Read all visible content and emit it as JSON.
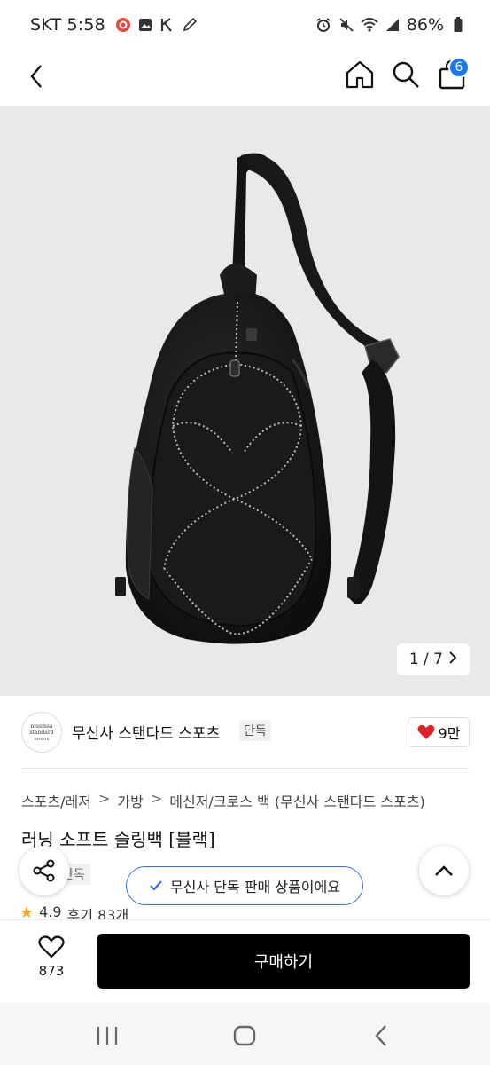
{
  "status_bar": {
    "carrier_time": "SKT 5:58",
    "battery": "86%",
    "icons_left": [
      "notification-app-icon",
      "gallery-icon",
      "k-app-icon",
      "pen-icon"
    ],
    "icons_right": [
      "alarm-icon",
      "mute-icon",
      "wifi-icon",
      "signal-icon",
      "battery-icon"
    ]
  },
  "nav": {
    "back_icon": "back-chevron-icon",
    "home_icon": "home-icon",
    "search_icon": "search-icon",
    "cart_icon": "shopping-bag-icon",
    "cart_badge": "6",
    "badge_color": "#1877f2"
  },
  "gallery": {
    "counter": "1 / 7",
    "current": 1,
    "total": 7,
    "background": "#e9e9e9"
  },
  "brand": {
    "logo_lines": [
      "musinsa",
      "standard",
      "SPORTS"
    ],
    "name": "무신사 스탠다드 스포츠",
    "tag": "단독",
    "likes": "9만",
    "heart_color": "#e0202a"
  },
  "breadcrumb": {
    "items": [
      "스포츠/레저",
      "가방",
      "메신저/크로스 백 (무신사 스탠다드 스포츠)"
    ],
    "separator": ">"
  },
  "product": {
    "title": "러닝 소프트 슬링백 [블랙]",
    "tag": "단독",
    "rating": "4.9",
    "reviews": "후기 83개"
  },
  "floating": {
    "exclusive_notice": "무신사 단독 판매 상품이에요",
    "notice_border": "#3a6fd8"
  },
  "bottom": {
    "wish_count": "873",
    "buy_label": "구매하기"
  }
}
